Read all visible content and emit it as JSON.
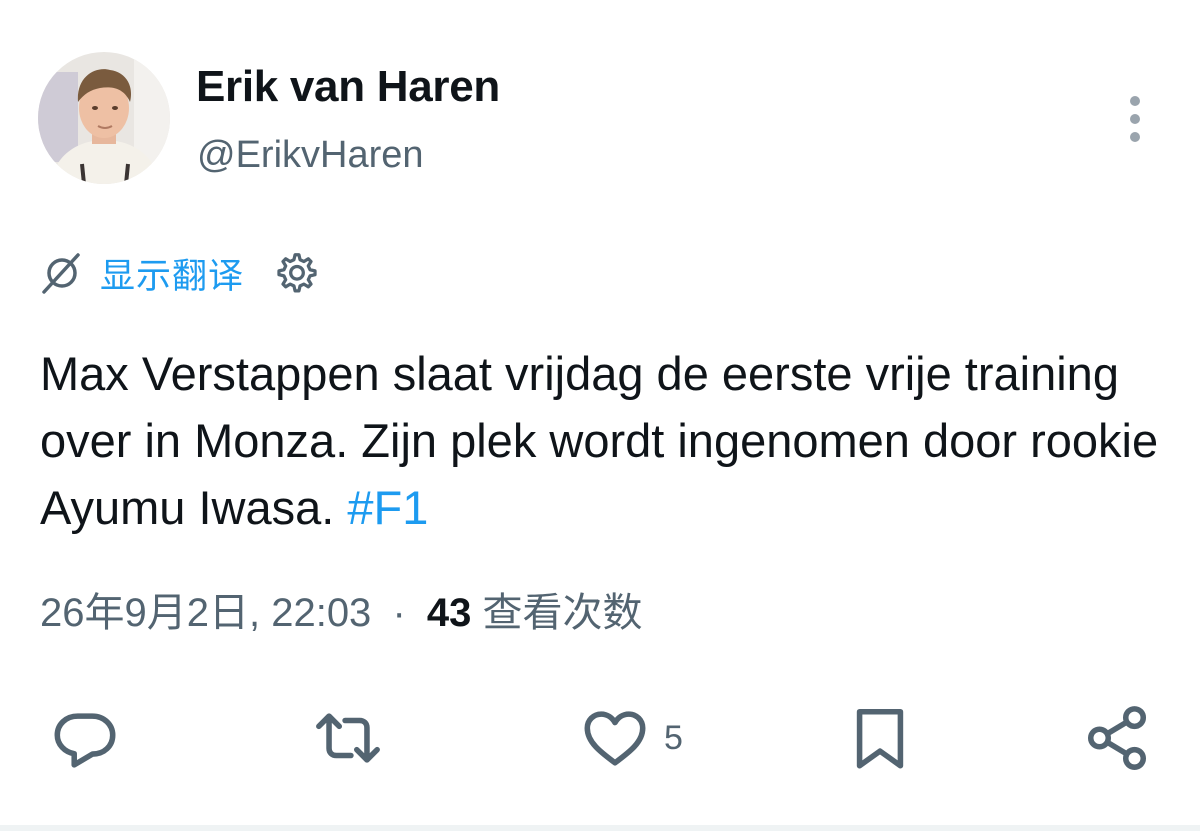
{
  "author": {
    "name": "Erik van Haren",
    "handle": "@ErikvHaren"
  },
  "translate": {
    "label": "显示翻译"
  },
  "tweet": {
    "text": "Max Verstappen slaat vrijdag de eerste vrije training over in Monza. Zijn plek wordt ingenomen door rookie Ayumu Iwasa.",
    "hashtag": "#F1"
  },
  "meta": {
    "date": "26年9月2日, 22:03",
    "separator": "·",
    "views_count": "43",
    "views_label": "查看次数"
  },
  "actions": {
    "like_count": "5"
  },
  "icons": {
    "more": "more-vertical-icon",
    "translate": "translate-globe-icon",
    "settings": "gear-icon",
    "reply": "reply-icon",
    "retweet": "retweet-icon",
    "like": "heart-icon",
    "bookmark": "bookmark-icon",
    "share": "share-icon"
  },
  "colors": {
    "accent": "#1d9bf0",
    "secondary_text": "#536471",
    "primary_text": "#0f1419",
    "icon": "#536471"
  }
}
